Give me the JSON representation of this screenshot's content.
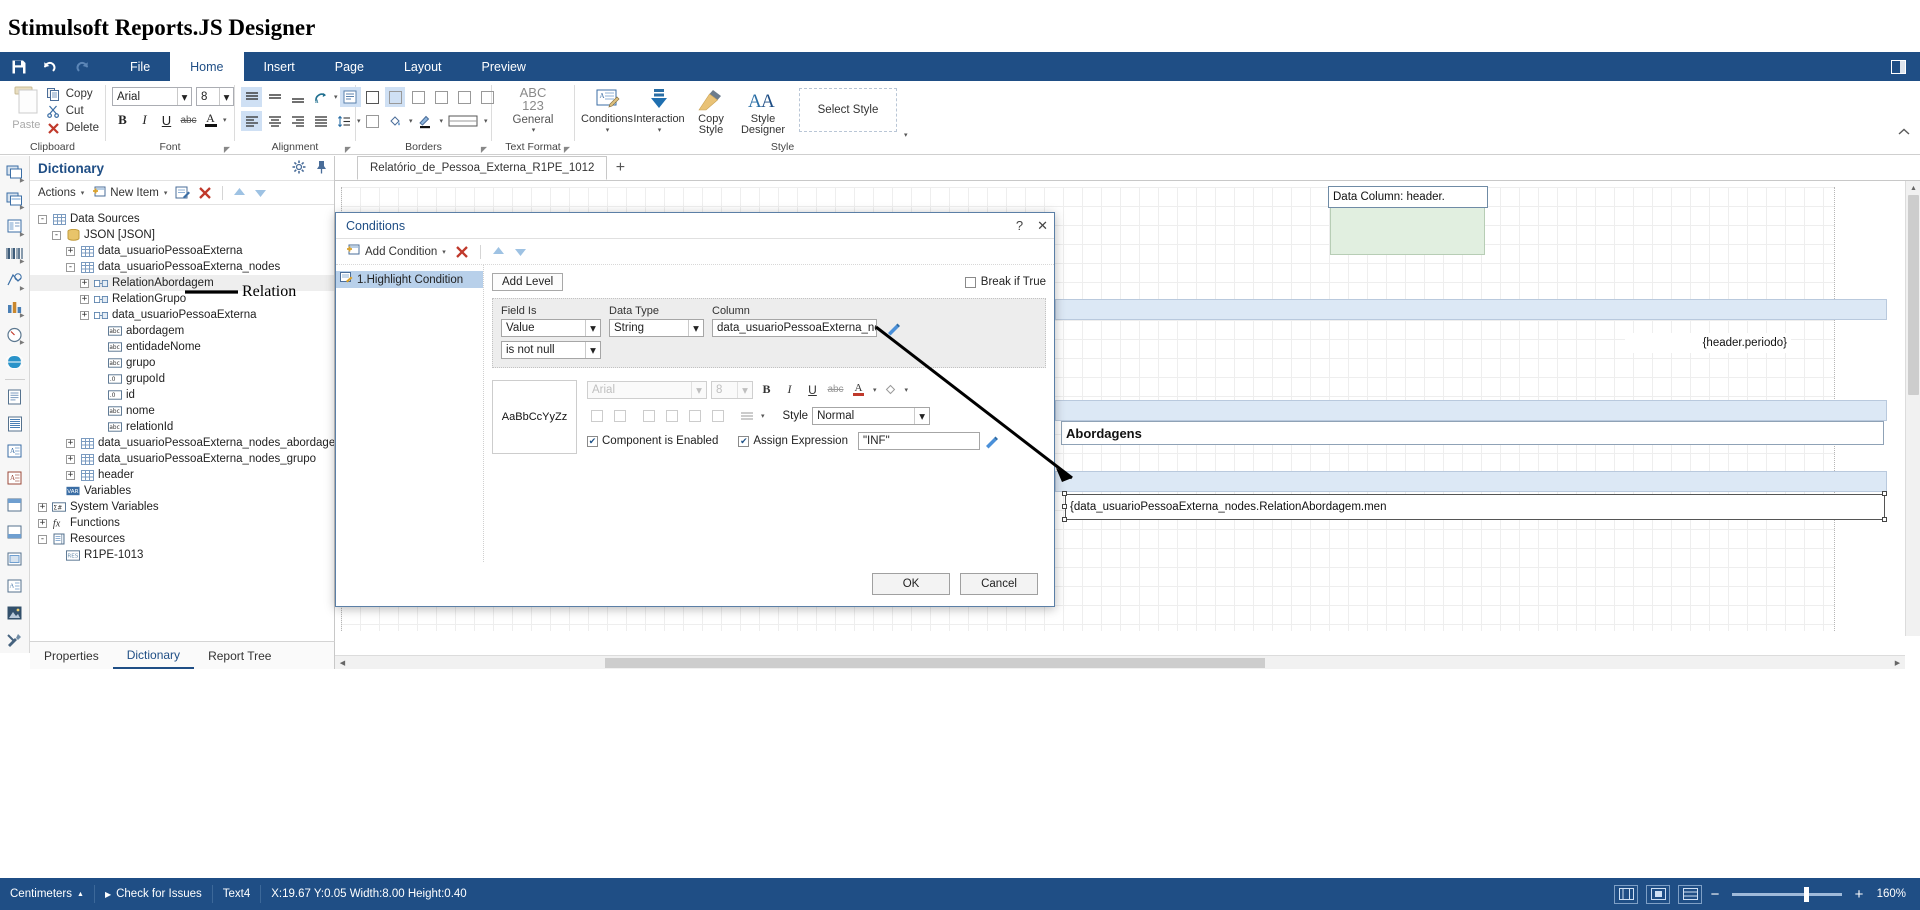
{
  "app": {
    "title": "Stimulsoft Reports.JS Designer"
  },
  "quick_access": [
    {
      "name": "save-icon",
      "label": "Save"
    },
    {
      "name": "undo-icon",
      "label": "Undo"
    },
    {
      "name": "redo-icon",
      "label": "Redo"
    }
  ],
  "ribbon": {
    "tabs": [
      {
        "label": "File",
        "active": false
      },
      {
        "label": "Home",
        "active": true
      },
      {
        "label": "Insert",
        "active": false
      },
      {
        "label": "Page",
        "active": false
      },
      {
        "label": "Layout",
        "active": false
      },
      {
        "label": "Preview",
        "active": false
      }
    ],
    "groups": {
      "clipboard": {
        "label": "Clipboard",
        "paste": "Paste",
        "items": [
          {
            "label": "Copy",
            "icon": "copy-icon"
          },
          {
            "label": "Cut",
            "icon": "cut-icon"
          },
          {
            "label": "Delete",
            "icon": "delete-icon"
          }
        ]
      },
      "font": {
        "label": "Font",
        "font_name": "Arial",
        "font_size": "8",
        "buttons": [
          "B",
          "I",
          "U",
          "abc"
        ]
      },
      "alignment": {
        "label": "Alignment"
      },
      "borders": {
        "label": "Borders"
      },
      "text_format": {
        "label": "Text Format",
        "abc": "ABC",
        "num": "123",
        "value": "General"
      },
      "style": {
        "label": "Style",
        "conditions": "Conditions",
        "interaction": "Interaction",
        "copy_style": "Copy Style",
        "style_designer_1": "Style",
        "style_designer_2": "Designer",
        "select_style": "Select Style"
      }
    }
  },
  "dictionary": {
    "title": "Dictionary",
    "toolbar": {
      "actions": "Actions",
      "new_item": "New Item"
    },
    "tree": [
      {
        "level": 0,
        "exp": "-",
        "icon": "table-icon",
        "label": "Data Sources"
      },
      {
        "level": 1,
        "exp": "-",
        "icon": "json-icon",
        "label": "JSON [JSON]"
      },
      {
        "level": 2,
        "exp": "+",
        "icon": "table-icon",
        "label": "data_usuarioPessoaExterna"
      },
      {
        "level": 2,
        "exp": "-",
        "icon": "table-icon",
        "label": "data_usuarioPessoaExterna_nodes"
      },
      {
        "level": 3,
        "exp": "+",
        "icon": "relation-icon",
        "label": "RelationAbordagem",
        "selected": true
      },
      {
        "level": 3,
        "exp": "+",
        "icon": "relation-icon",
        "label": "RelationGrupo"
      },
      {
        "level": 3,
        "exp": "+",
        "icon": "relation-icon",
        "label": "data_usuarioPessoaExterna"
      },
      {
        "level": 4,
        "exp": "",
        "icon": "abc-icon",
        "label": "abordagem"
      },
      {
        "level": 4,
        "exp": "",
        "icon": "abc-icon",
        "label": "entidadeNome"
      },
      {
        "level": 4,
        "exp": "",
        "icon": "abc-icon",
        "label": "grupo"
      },
      {
        "level": 4,
        "exp": "",
        "icon": "number-icon",
        "label": "grupoId"
      },
      {
        "level": 4,
        "exp": "",
        "icon": "number-icon",
        "label": "id"
      },
      {
        "level": 4,
        "exp": "",
        "icon": "abc-icon",
        "label": "nome"
      },
      {
        "level": 4,
        "exp": "",
        "icon": "abc-icon",
        "label": "relationId"
      },
      {
        "level": 2,
        "exp": "+",
        "icon": "table-icon",
        "label": "data_usuarioPessoaExterna_nodes_abordagem"
      },
      {
        "level": 2,
        "exp": "+",
        "icon": "table-icon",
        "label": "data_usuarioPessoaExterna_nodes_grupo"
      },
      {
        "level": 2,
        "exp": "+",
        "icon": "table-icon",
        "label": "header"
      },
      {
        "level": 1,
        "exp": "",
        "icon": "var-icon",
        "label": "Variables"
      },
      {
        "level": 0,
        "exp": "+",
        "icon": "sysvar-icon",
        "label": "System Variables"
      },
      {
        "level": 0,
        "exp": "+",
        "icon": "function-icon",
        "label": "Functions"
      },
      {
        "level": 0,
        "exp": "-",
        "icon": "resources-icon",
        "label": "Resources"
      },
      {
        "level": 1,
        "exp": "",
        "icon": "resource-item-icon",
        "label": "R1PE-1013"
      }
    ],
    "tabs": [
      {
        "label": "Properties",
        "active": false
      },
      {
        "label": "Dictionary",
        "active": true
      },
      {
        "label": "Report Tree",
        "active": false
      }
    ]
  },
  "workspace": {
    "tab": "Relatório_de_Pessoa_Externa_R1PE_1012",
    "add_tab": "+",
    "components": [
      {
        "name": "data-column-header",
        "text": "Data Column: header."
      },
      {
        "name": "header-periodo-expression",
        "text": "{header.periodo}"
      },
      {
        "name": "abordagens-title",
        "text": "Abordagens"
      },
      {
        "name": "relation-abordagem-expression",
        "text": "{data_usuarioPessoaExterna_nodes.RelationAbordagem.men"
      }
    ]
  },
  "dialog": {
    "title": "Conditions",
    "help": "?",
    "close": "✕",
    "toolbar": {
      "add_condition": "Add Condition",
      "delete": "✕",
      "move_up": "▲",
      "move_down": "▼"
    },
    "condition_items": [
      {
        "label": "1.Highlight Condition",
        "selected": true
      }
    ],
    "add_level": "Add Level",
    "break_if_true": "Break if True",
    "break_if_true_checked": false,
    "fields": {
      "field_is_label": "Field Is",
      "data_type_label": "Data Type",
      "column_label": "Column",
      "field_is_value": "Value",
      "data_type_value": "String",
      "column_value": "data_usuarioPessoaExterna_nodes",
      "operator_value": "is not null"
    },
    "style": {
      "preview_text": "AaBbCcYyZz",
      "font_name": "Arial",
      "font_size": "8",
      "style_label": "Style",
      "style_value": "Normal",
      "component_enabled_label": "Component is Enabled",
      "component_enabled_checked": true,
      "assign_expression_label": "Assign Expression",
      "assign_expression_checked": true,
      "assign_expression_value": "\"INF\""
    },
    "ok": "OK",
    "cancel": "Cancel"
  },
  "annotations": [
    {
      "name": "relation-annotation",
      "text": "Relation"
    }
  ],
  "status_bar": {
    "units": "Centimeters",
    "check_issues": "Check for Issues",
    "component": "Text4",
    "coords": "X:19.67 Y:0.05 Width:8.00 Height:0.40",
    "zoom": "160%",
    "minus": "−",
    "plus": "+"
  },
  "colors": {
    "brand": "#1f4e85",
    "selection": "#b8d0ea",
    "band_blue": "#dce8f5",
    "band_green": "#e1efe0"
  }
}
